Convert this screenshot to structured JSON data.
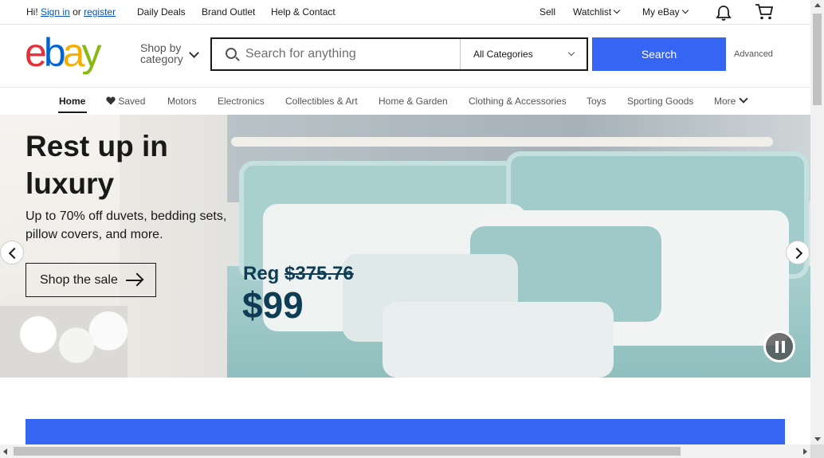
{
  "topbar": {
    "greeting": "Hi!",
    "signin": "Sign in",
    "or": "or",
    "register": "register",
    "daily_deals": "Daily Deals",
    "brand_outlet": "Brand Outlet",
    "help": "Help & Contact",
    "sell": "Sell",
    "watchlist": "Watchlist",
    "my_ebay": "My eBay",
    "icons": {
      "notifications": "bell-icon",
      "cart": "cart-icon"
    }
  },
  "header": {
    "logo": [
      "e",
      "b",
      "a",
      "y"
    ],
    "logo_colors": [
      "#e53238",
      "#0064d2",
      "#f5af02",
      "#86b817"
    ],
    "shop_by_category": [
      "Shop by",
      "category"
    ],
    "search_placeholder": "Search for anything",
    "category_selected": "All Categories",
    "search_button": "Search",
    "advanced": "Advanced",
    "accent_color": "#3665f3"
  },
  "nav": {
    "items": [
      {
        "label": "Home",
        "active": true
      },
      {
        "label": "Saved"
      },
      {
        "label": "Motors"
      },
      {
        "label": "Electronics"
      },
      {
        "label": "Collectibles & Art"
      },
      {
        "label": "Home & Garden"
      },
      {
        "label": "Clothing & Accessories"
      },
      {
        "label": "Toys"
      },
      {
        "label": "Sporting Goods"
      },
      {
        "label": "More"
      }
    ]
  },
  "hero": {
    "title": "Rest up in luxury",
    "subtitle": "Up to 70% off duvets, bedding sets, pillow covers, and more.",
    "cta": "Shop the sale",
    "price_reg_label": "Reg",
    "price_reg_value": "$375.76",
    "price_now": "$99"
  }
}
